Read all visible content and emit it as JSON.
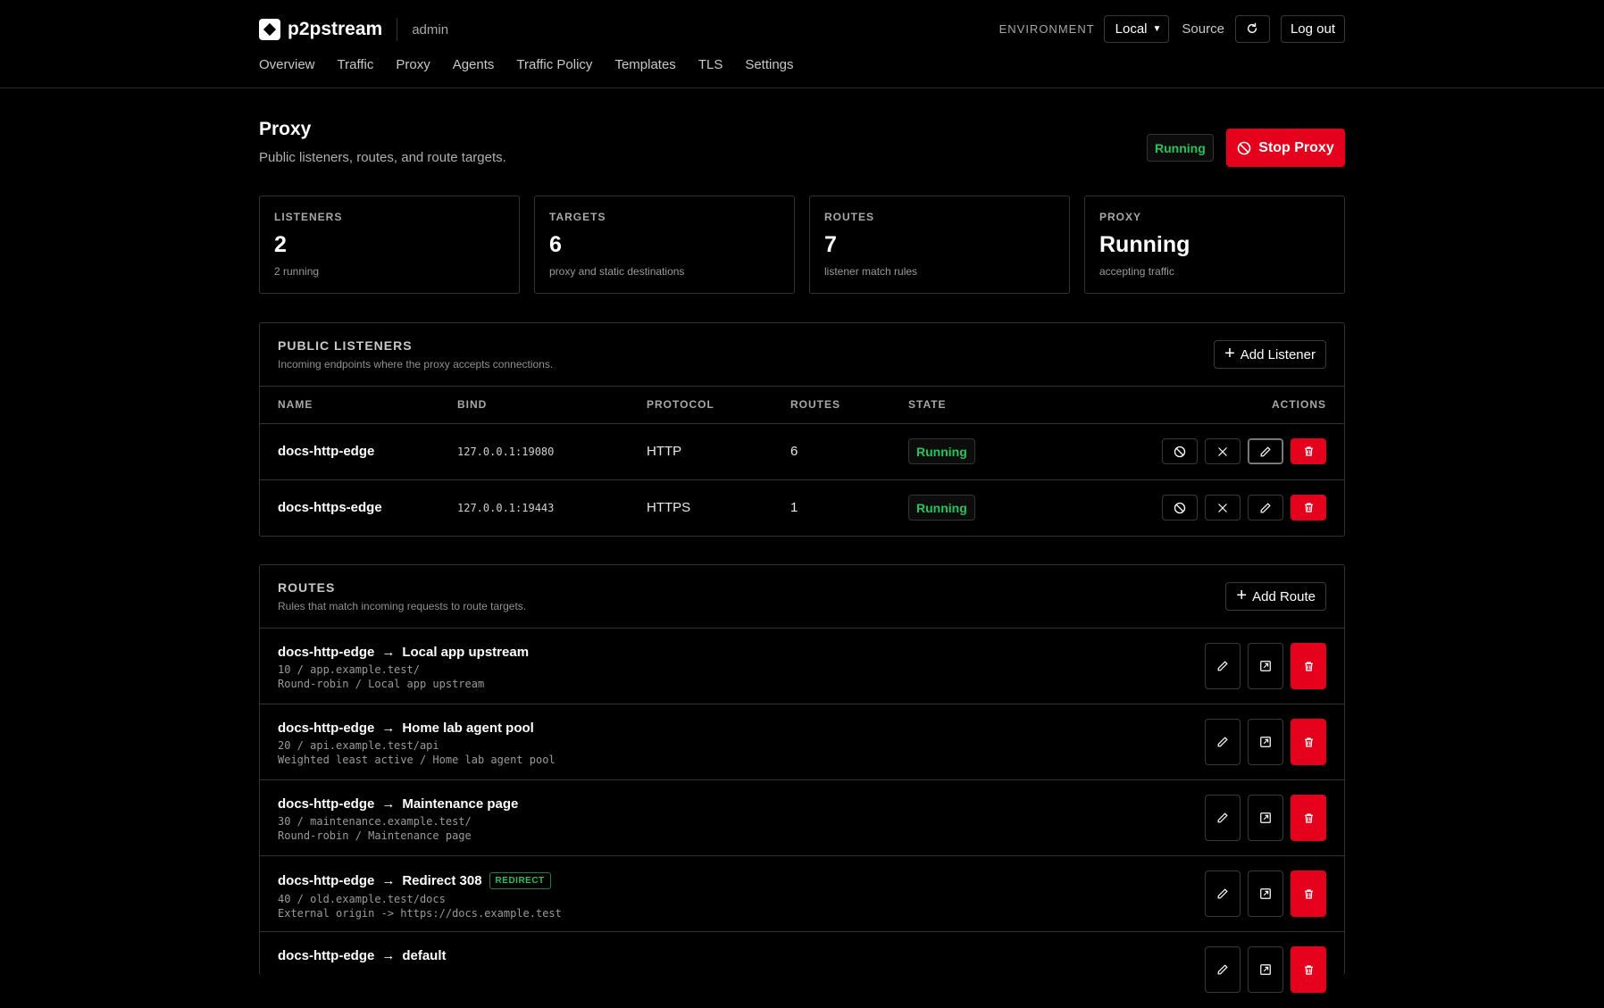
{
  "app": {
    "name": "p2pstream",
    "user": "admin",
    "environment_label": "ENVIRONMENT",
    "environment_value": "Local",
    "source_label": "Source",
    "logout_label": "Log out"
  },
  "nav": [
    "Overview",
    "Traffic",
    "Proxy",
    "Agents",
    "Traffic Policy",
    "Templates",
    "TLS",
    "Settings"
  ],
  "page": {
    "title": "Proxy",
    "subtitle": "Public listeners, routes, and route targets.",
    "status": "Running",
    "stop_label": "Stop Proxy"
  },
  "stats": [
    {
      "label": "LISTENERS",
      "value": "2",
      "sub": "2 running"
    },
    {
      "label": "TARGETS",
      "value": "6",
      "sub": "proxy and static destinations"
    },
    {
      "label": "ROUTES",
      "value": "7",
      "sub": "listener match rules"
    },
    {
      "label": "PROXY",
      "value": "Running",
      "sub": "accepting traffic"
    }
  ],
  "listeners": {
    "title": "PUBLIC LISTENERS",
    "desc": "Incoming endpoints where the proxy accepts connections.",
    "add_label": "Add Listener",
    "columns": [
      "NAME",
      "BIND",
      "PROTOCOL",
      "ROUTES",
      "STATE",
      "ACTIONS"
    ],
    "rows": [
      {
        "name": "docs-http-edge",
        "bind": "127.0.0.1:19080",
        "protocol": "HTTP",
        "routes": "6",
        "state": "Running"
      },
      {
        "name": "docs-https-edge",
        "bind": "127.0.0.1:19443",
        "protocol": "HTTPS",
        "routes": "1",
        "state": "Running"
      }
    ]
  },
  "routes": {
    "title": "ROUTES",
    "desc": "Rules that match incoming requests to route targets.",
    "add_label": "Add Route",
    "rows": [
      {
        "listener": "docs-http-edge",
        "arrow": "→",
        "target": "Local app upstream",
        "tag": "",
        "line1": "10 / app.example.test/",
        "line2": "Round-robin / Local app upstream"
      },
      {
        "listener": "docs-http-edge",
        "arrow": "→",
        "target": "Home lab agent pool",
        "tag": "",
        "line1": "20 / api.example.test/api",
        "line2": "Weighted least active / Home lab agent pool"
      },
      {
        "listener": "docs-http-edge",
        "arrow": "→",
        "target": "Maintenance page",
        "tag": "",
        "line1": "30 / maintenance.example.test/",
        "line2": "Round-robin / Maintenance page"
      },
      {
        "listener": "docs-http-edge",
        "arrow": "→",
        "target": "Redirect 308",
        "tag": "REDIRECT",
        "line1": "40 / old.example.test/docs",
        "line2": "External origin -> https://docs.example.test"
      },
      {
        "listener": "docs-http-edge",
        "arrow": "→",
        "target": "default",
        "tag": "",
        "line1": "",
        "line2": ""
      }
    ]
  },
  "colors": {
    "accent_red": "#e5001b",
    "running_green": "#22c55e",
    "background": "#000000"
  }
}
